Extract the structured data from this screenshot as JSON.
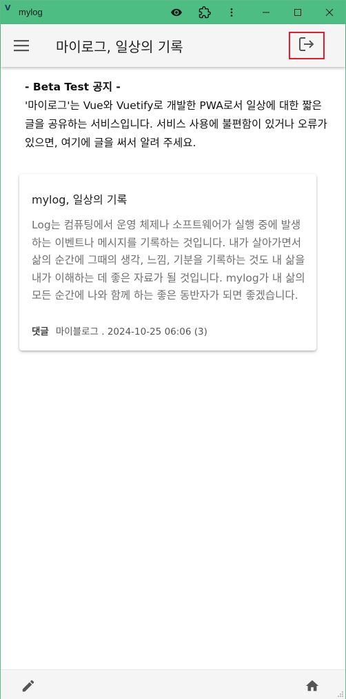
{
  "window": {
    "title": "mylog",
    "titlebar_color": "#4dbd84"
  },
  "appbar": {
    "title": "마이로그, 일상의 기록",
    "menu_icon": "hamburger-menu-icon",
    "logout_icon": "logout-icon",
    "highlight_color": "#e8192c"
  },
  "notice": {
    "title": "- Beta Test 공지 -",
    "body": "'마이로그'는 Vue와 Vuetify로 개발한 PWA로서 일상에 대한 짧은 글을 공유하는 서비스입니다. 서비스 사용에 불편함이 있거나 오류가 있으면, 여기에 글을 써서 알려 주세요."
  },
  "posts": [
    {
      "title": "mylog, 일상의 기록",
      "body": "Log는 컴퓨팅에서 운영 체제나 소프트웨어가 실행 중에 발생하는 이벤트나 메시지를 기록하는 것입니다. 내가 살아가면서 삶의 순간에 그때의 생각, 느낌, 기분을 기록하는 것도 내 삶을 내가 이해하는 데 좋은 자료가 될 것입니다. mylog가 내 삶의 모든 순간에 나와 함께 하는 좋은 동반자가 되면 좋겠습니다.",
      "comment_label": "댓글",
      "meta": "마이블로그 . 2024-10-25 06:06 (3)"
    }
  ],
  "bottombar": {
    "edit_icon": "pencil-icon",
    "home_icon": "home-icon"
  }
}
